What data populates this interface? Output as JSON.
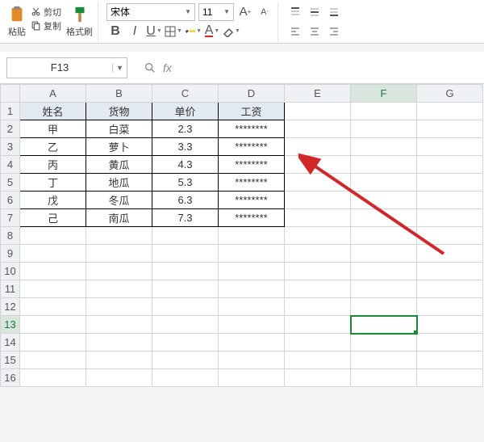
{
  "ribbon": {
    "paste_label": "粘贴",
    "cut_label": "剪切",
    "copy_label": "复制",
    "format_painter_label": "格式刷",
    "font_name": "宋体",
    "font_size": "11",
    "inc_font": "A",
    "dec_font": "A",
    "bold": "B",
    "italic": "I",
    "underline": "U",
    "font_color_letter": "A"
  },
  "name_box": {
    "value": "F13"
  },
  "formula_bar": {
    "fx_label": "fx"
  },
  "grid": {
    "columns": [
      "A",
      "B",
      "C",
      "D",
      "E",
      "F",
      "G"
    ],
    "row_count": 16,
    "selected_cell": {
      "row": 13,
      "col": "F"
    },
    "data_headers": [
      "姓名",
      "货物",
      "单价",
      "工资"
    ],
    "data_rows": [
      {
        "name": "甲",
        "goods": "白菜",
        "price": "2.3",
        "salary": "********"
      },
      {
        "name": "乙",
        "goods": "萝卜",
        "price": "3.3",
        "salary": "********"
      },
      {
        "name": "丙",
        "goods": "黄瓜",
        "price": "4.3",
        "salary": "********"
      },
      {
        "name": "丁",
        "goods": "地瓜",
        "price": "5.3",
        "salary": "********"
      },
      {
        "name": "戊",
        "goods": "冬瓜",
        "price": "6.3",
        "salary": "********"
      },
      {
        "name": "己",
        "goods": "南瓜",
        "price": "7.3",
        "salary": "********"
      }
    ]
  },
  "chart_data": {
    "type": "table",
    "title": "",
    "columns": [
      "姓名",
      "货物",
      "单价",
      "工资"
    ],
    "rows": [
      [
        "甲",
        "白菜",
        2.3,
        "********"
      ],
      [
        "乙",
        "萝卜",
        3.3,
        "********"
      ],
      [
        "丙",
        "黄瓜",
        4.3,
        "********"
      ],
      [
        "丁",
        "地瓜",
        5.3,
        "********"
      ],
      [
        "戊",
        "冬瓜",
        6.3,
        "********"
      ],
      [
        "己",
        "南瓜",
        7.3,
        "********"
      ]
    ]
  }
}
